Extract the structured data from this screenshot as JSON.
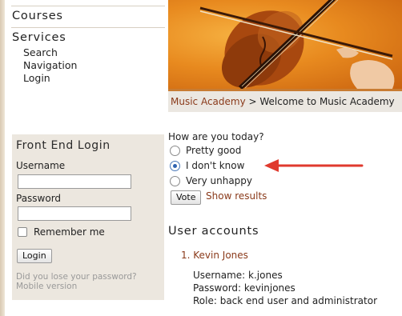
{
  "nav": {
    "courses": "Courses",
    "services": "Services",
    "items": [
      "Search",
      "Navigation",
      "Login"
    ]
  },
  "login": {
    "title": "Front End Login",
    "username_label": "Username",
    "password_label": "Password",
    "username_value": "",
    "password_value": "",
    "remember_label": "Remember me",
    "login_button": "Login",
    "lost_password": "Did you lose your password?",
    "mobile_version": "Mobile version"
  },
  "breadcrumb": {
    "home": "Music Academy",
    "separator": " > ",
    "current": "Welcome to Music Academy"
  },
  "poll": {
    "question": "How are you today?",
    "options": [
      {
        "label": "Pretty good",
        "selected": false
      },
      {
        "label": "I don't know",
        "selected": true
      },
      {
        "label": "Very unhappy",
        "selected": false
      }
    ],
    "vote_button": "Vote",
    "show_results": "Show results"
  },
  "users": {
    "title": "User accounts",
    "entry_label": "1. Kevin Jones",
    "username_line": "Username: k.jones",
    "password_line": "Password: kevinjones",
    "role_line": "Role: back end user and administrator"
  },
  "colors": {
    "link": "#8a3a1a",
    "arrow": "#e03a2e",
    "sidebar_box": "#ece7df",
    "breadcrumb_bar": "#ebe7e1",
    "banner": "#e88a1f"
  },
  "icons": {
    "banner_image": "violin-photo",
    "annotation": "red-arrow-left"
  }
}
